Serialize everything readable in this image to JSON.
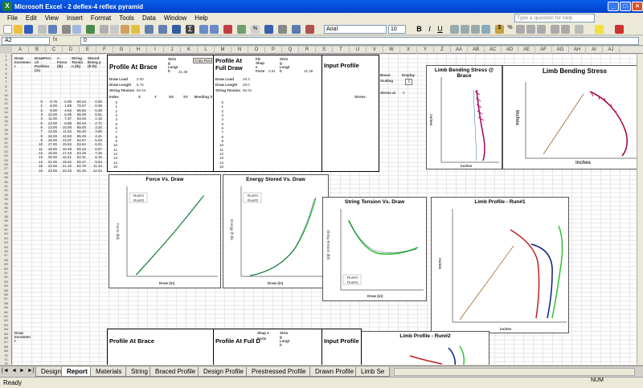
{
  "window": {
    "title": "Microsoft Excel - 2 deflex-4 reflex pyramid"
  },
  "menu": [
    "File",
    "Edit",
    "View",
    "Insert",
    "Format",
    "Tools",
    "Data",
    "Window",
    "Help"
  ],
  "help_placeholder": "Type a question for help",
  "font": {
    "name": "Arial",
    "size": "10"
  },
  "formula": {
    "cell": "A2",
    "fx": "fx",
    "value": "0"
  },
  "columns": [
    "A",
    "B",
    "C",
    "D",
    "E",
    "F",
    "G",
    "H",
    "I",
    "J",
    "K",
    "L",
    "M",
    "N",
    "O",
    "P",
    "Q",
    "R",
    "S",
    "T",
    "U",
    "V",
    "W",
    "X",
    "Y",
    "Z",
    "AA",
    "AB",
    "AC",
    "AD",
    "AE",
    "AF",
    "AG",
    "AH",
    "AI",
    "AJ"
  ],
  "left_headers": {
    "h1": "Draw Incremen t",
    "h2": "DrawPerc ch Partition (in)",
    "h3": "n Force (lb)",
    "h4": "String Tensio n (lb)",
    "h5": "Stored Energ y (ft-lb)"
  },
  "left_values": {
    "rows": [
      "1",
      "2",
      "3",
      "4",
      "5",
      "6",
      "7",
      "8",
      "9",
      "10",
      "11",
      "12",
      "13",
      "14",
      "15",
      "16",
      "17",
      "18",
      "19",
      "20",
      "21",
      "22",
      "23",
      "24",
      "25",
      "26",
      "27"
    ],
    "col1": [
      "0",
      "1",
      "2",
      "3",
      "4",
      "5",
      "6",
      "7",
      "8",
      "9",
      "10",
      "11",
      "12",
      "13",
      "14",
      "15",
      "16",
      "17",
      "18",
      "19",
      "20",
      "21",
      "22",
      "23",
      "24"
    ],
    "col2": [
      "6.75",
      "8.00",
      "9.00",
      "10.00",
      "11.00",
      "12.00",
      "13.00",
      "14.00",
      "15.00",
      "16.00",
      "17.00",
      "18.00",
      "19.00",
      "20.00",
      "21.00",
      "22.00",
      "23.00",
      "24.00",
      "25.00",
      "26.00",
      "27.00",
      "28.00",
      "29.00",
      "30.00",
      "28.00"
    ],
    "col3": [
      "0.00",
      "1.68",
      "4.64",
      "6.05",
      "7.37",
      "8.88",
      "10.08",
      "11.64",
      "12.94",
      "14.07",
      "15.84",
      "16.48",
      "17.23",
      "18.41",
      "19.62",
      "21.10",
      "22.43",
      "23.50",
      "24.00",
      "24.54",
      "26.01",
      "26.41",
      "27.74",
      "29.24",
      "28.05"
    ],
    "col4": [
      "60.44",
      "72.07",
      "66.82",
      "65.09",
      "63.46",
      "60.34",
      "58.00",
      "56.40",
      "55.49",
      "54.87",
      "53.64",
      "52.33",
      "53.28",
      "52.31",
      "52.47",
      "52.78",
      "51.46",
      "51.52",
      "51.52",
      "51.79",
      "52.56",
      "52.97",
      "53.30",
      "54.97",
      "29.24"
    ],
    "col5": [
      "0.00",
      "0.06",
      "0.38",
      "0.61",
      "1.16",
      "2.71",
      "3.32",
      "3.85",
      "4.41",
      "5.03",
      "6.01",
      "6.57",
      "7.26",
      "8.15",
      "9.54",
      "11.10",
      "12.44",
      "13.80",
      "15.49",
      "17.19",
      "19.68",
      "21.53",
      "23.90",
      "24.50",
      "24.90"
    ]
  },
  "profile_brace": {
    "title": "Profile At Brace",
    "strlen_label": "Strin g Lengt h",
    "strlen": "31.38",
    "copy_run": "Copy Run",
    "brace_load_label": "Draw Load",
    "brace_load": "0.00",
    "draw_len_label": "Draw Length",
    "draw_len": "6.75",
    "stress_label": "String Tension",
    "stress": "60.44",
    "cols": [
      "Index",
      "X",
      "Y",
      "SX",
      "SY",
      "Bending S"
    ]
  },
  "profile_full": {
    "title": "Profile At Full Draw",
    "draw_load_label": "Draw Load",
    "draw_load": "29.3",
    "draw_len_label": "Draw Length",
    "draw_len": "28.0",
    "tension_label": "String Tension",
    "tension": "55.91",
    "fd_shape": "FD Shap e",
    "forte": "Forte",
    "forte_val": "0.91",
    "strlen_label": "Strin g Lengt h",
    "strlen": "31.38"
  },
  "input_profile": {
    "title": "Input Profile",
    "stress": "Stress",
    "brace_label": "Brace",
    "display_label": "Display",
    "scaling_label": "Scaling",
    "scaling": "3",
    "stress_at": "Stress at",
    "stress_at_val": "0"
  },
  "charts": {
    "limb_brace": {
      "title": "Limb Bending Stress @ Brace",
      "xlabel": "inches",
      "ylabel": "inches"
    },
    "limb_stress": {
      "title": "Limb Bending Stress",
      "xlabel": "inches",
      "ylabel": "inches"
    },
    "force_draw": {
      "title": "Force Vs. Draw",
      "xlabel": "Draw (in)",
      "ylabel": "Force (lbf)",
      "legend": [
        "Run#1",
        "Run#2"
      ]
    },
    "energy": {
      "title": "Energy Stored Vs. Draw",
      "xlabel": "Draw (in)",
      "ylabel": "Energy (ft-lb)",
      "legend": [
        "Run#1",
        "Run#2"
      ]
    },
    "tension": {
      "title": "String Tension Vs. Draw",
      "xlabel": "Draw (in)",
      "ylabel": "String Tension (lbf)",
      "legend": [
        "Run#1",
        "Run#2"
      ]
    },
    "limb_profile1": {
      "title": "Limb Profile - Run#1",
      "xlabel": "inches",
      "ylabel": "inches"
    },
    "limb_profile2": {
      "title": "Limb Profile - Run#2"
    }
  },
  "lower": {
    "draw_increment": "Draw Incremen t",
    "profile_brace": "Profile At Brace",
    "profile_full": "Profile At Full D",
    "input_profile": "Input Profile",
    "shap": "Shap e",
    "forte": "Forte",
    "string_len": "Strin g Lengt h"
  },
  "tabs": [
    "Design",
    "Report",
    "Materials",
    "String",
    "Braced Profile",
    "Design Profile",
    "Prestressed Profile",
    "Drawn Profile",
    "Limb Se"
  ],
  "active_tab": "Report",
  "status": {
    "left": "Ready",
    "num": "NUM"
  }
}
